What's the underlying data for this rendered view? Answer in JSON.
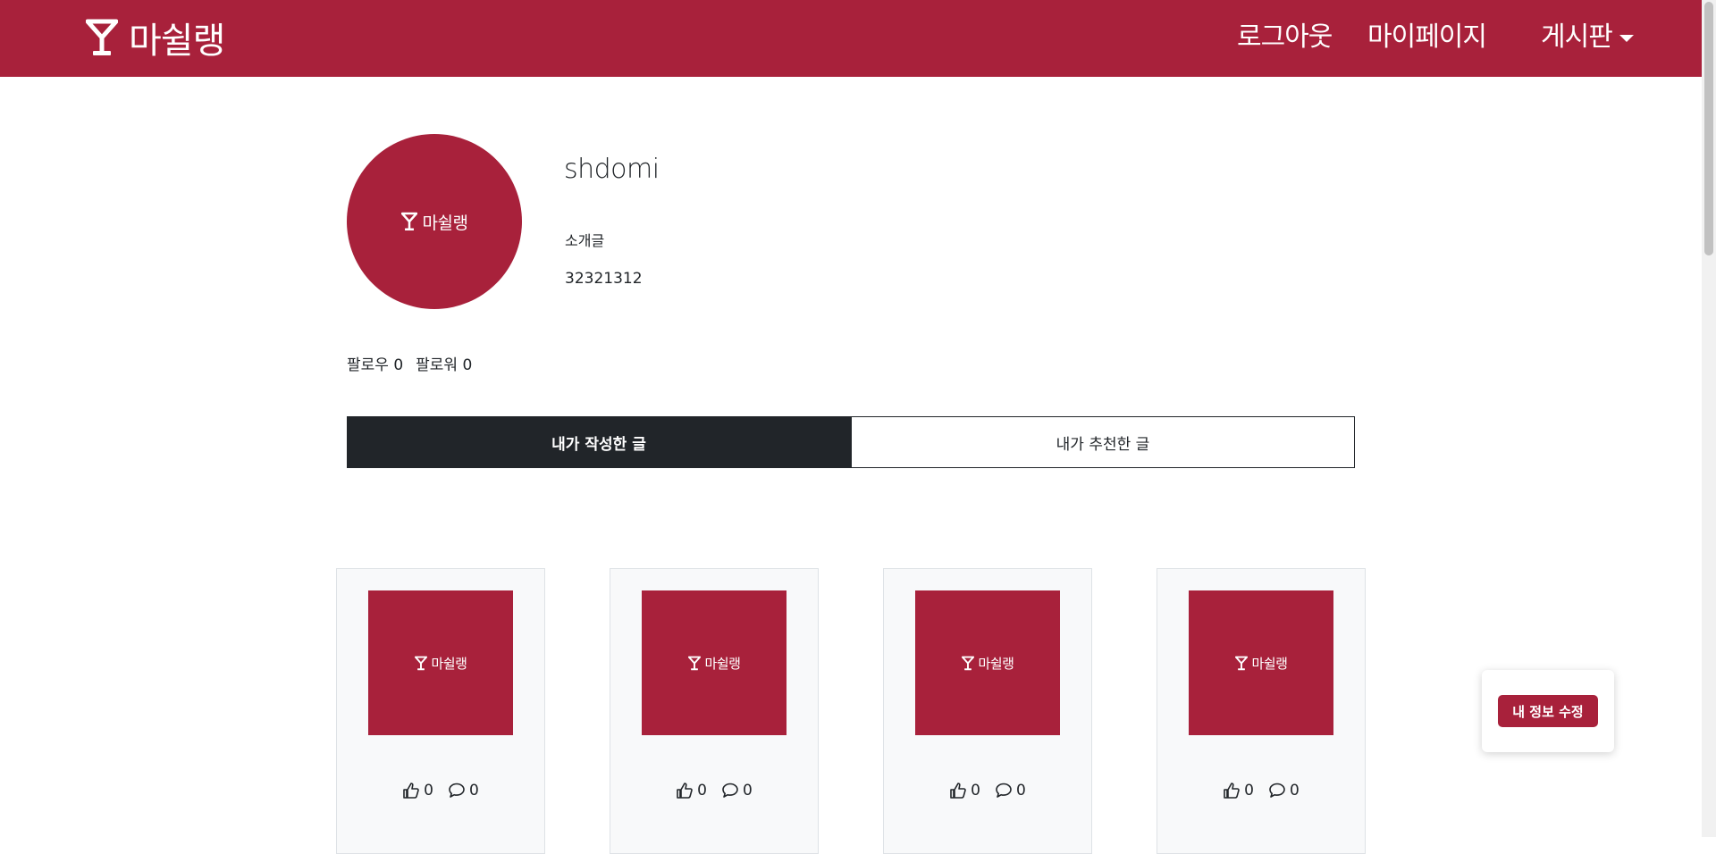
{
  "header": {
    "brand": "마쉴랭",
    "nav": {
      "logout": "로그아웃",
      "mypage": "마이페이지",
      "board": "게시판"
    }
  },
  "profile": {
    "avatar_text": "마쉴랭",
    "username": "shdomi",
    "intro_label": "소개글",
    "intro_text": "32321312",
    "follow_label": "팔로우",
    "follow_count": "0",
    "follower_label": "팔로워",
    "follower_count": "0"
  },
  "tabs": [
    {
      "label": "내가 작성한 글",
      "active": true
    },
    {
      "label": "내가 추천한 글",
      "active": false
    }
  ],
  "posts": [
    {
      "thumb_text": "마쉴랭",
      "likes": "0",
      "comments": "0"
    },
    {
      "thumb_text": "마쉴랭",
      "likes": "0",
      "comments": "0"
    },
    {
      "thumb_text": "마쉴랭",
      "likes": "0",
      "comments": "0"
    },
    {
      "thumb_text": "마쉴랭",
      "likes": "0",
      "comments": "0"
    }
  ],
  "edit_button": "내 정보 수정",
  "icons": {
    "logo": "cocktail-glass-icon",
    "like": "thumbs-up-icon",
    "comment": "chat-bubble-icon",
    "dropdown": "caret-down-icon"
  },
  "colors": {
    "brand": "#a8213b",
    "dark": "#212529",
    "card_bg": "#f8f9fa"
  }
}
